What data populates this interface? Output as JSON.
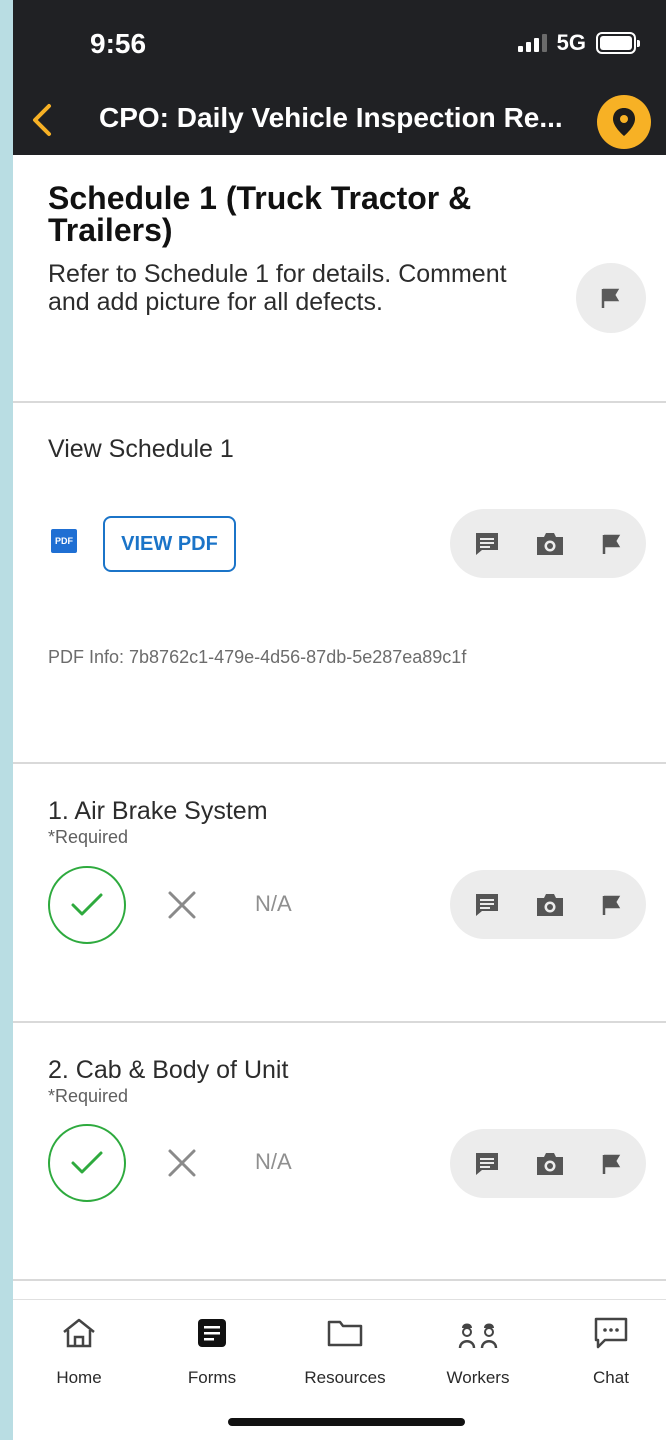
{
  "status_bar": {
    "time": "9:56",
    "network": "5G"
  },
  "nav": {
    "title": "CPO: Daily Vehicle Inspection Re..."
  },
  "section": {
    "title": "Schedule 1 (Truck Tractor & Trailers)",
    "description": "Refer to Schedule 1 for details. Comment and add picture for all defects."
  },
  "schedule": {
    "label": "View Schedule 1",
    "pdf_icon_text": "PDF",
    "view_pdf_label": "VIEW PDF",
    "pdf_info": "PDF Info: 7b8762c1-479e-4d56-87db-5e287ea89c1f"
  },
  "questions": [
    {
      "label": "1. Air Brake System",
      "required": "*Required",
      "na_label": "N/A",
      "answer": "yes"
    },
    {
      "label": "2. Cab & Body of Unit",
      "required": "*Required",
      "na_label": "N/A",
      "answer": "yes"
    }
  ],
  "tabs": [
    {
      "label": "Home",
      "icon": "home-icon"
    },
    {
      "label": "Forms",
      "icon": "forms-icon",
      "active": true
    },
    {
      "label": "Resources",
      "icon": "folder-icon"
    },
    {
      "label": "Workers",
      "icon": "workers-icon"
    },
    {
      "label": "Chat",
      "icon": "chat-icon"
    }
  ],
  "colors": {
    "accent": "#f7b125",
    "link": "#1b74c8",
    "success": "#2eaa3e",
    "header_bg": "#202124"
  }
}
